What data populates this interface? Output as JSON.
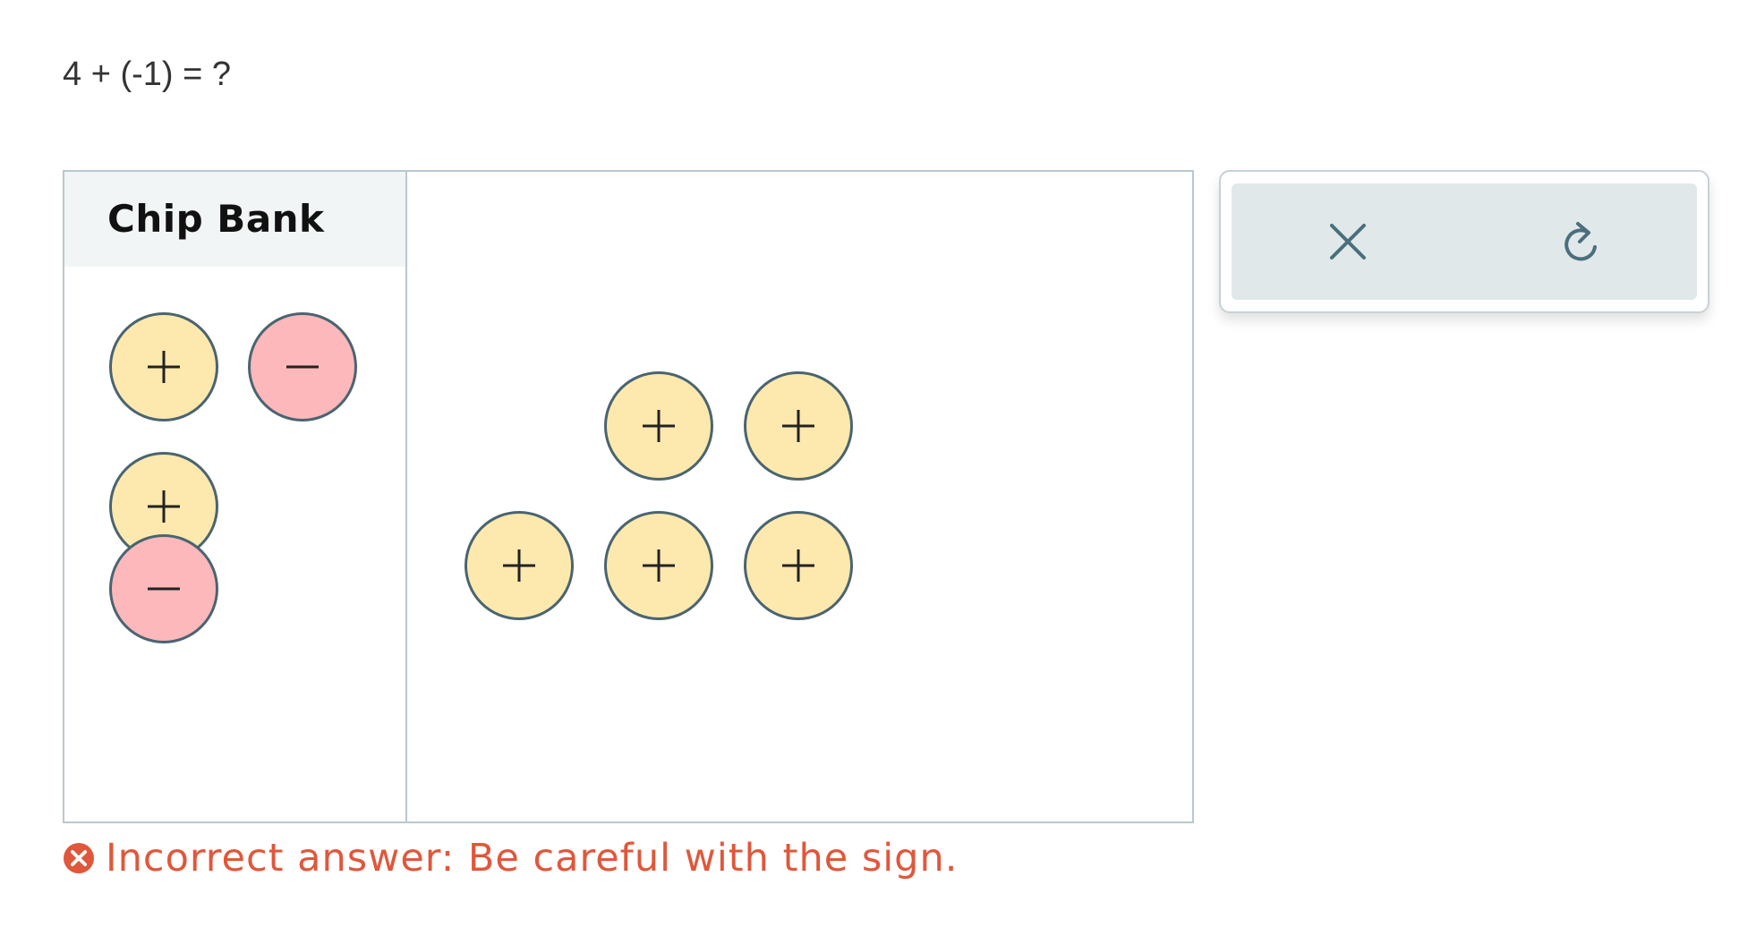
{
  "question": {
    "text": "4 + (-1) = ?"
  },
  "chip_bank": {
    "title": "Chip Bank"
  },
  "chip_symbols": {
    "positive": "+",
    "negative": "−"
  },
  "colors": {
    "positive_chip": "#fde9ad",
    "negative_chip": "#fcb8bb",
    "chip_border": "#4a6470",
    "error": "#e0573b"
  },
  "controls": {
    "clear_icon": "close-icon",
    "reset_icon": "redo-icon"
  },
  "workspace_chips": {
    "positive_count": 5,
    "negative_count": 0
  },
  "feedback": {
    "icon": "error-circle-icon",
    "text": "Incorrect answer: Be careful with the sign."
  }
}
